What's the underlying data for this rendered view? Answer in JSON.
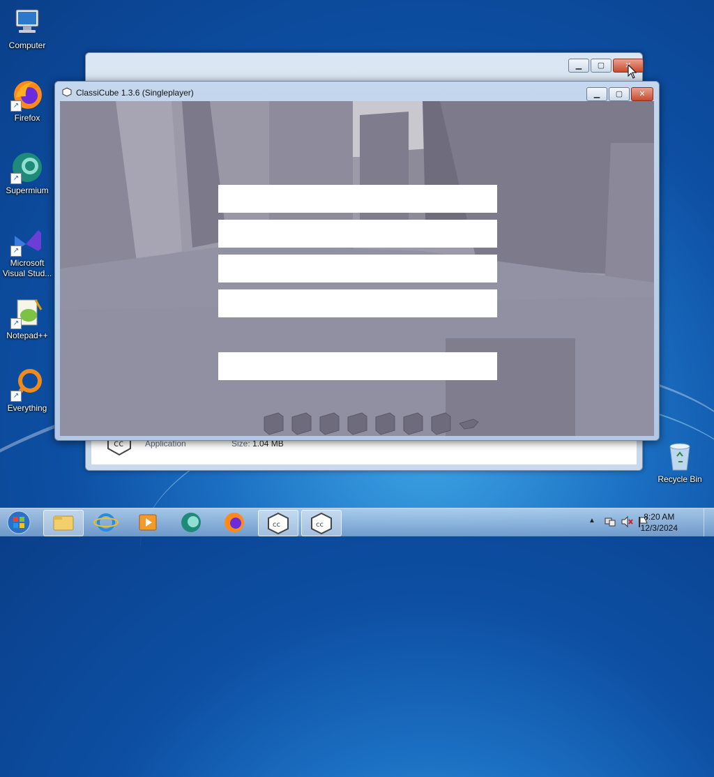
{
  "desktop": {
    "icons": [
      {
        "label": "Computer",
        "icon": "computer-icon"
      },
      {
        "label": "Firefox",
        "icon": "firefox-icon"
      },
      {
        "label": "Supermium",
        "icon": "supermium-icon"
      },
      {
        "label": "Microsoft Visual Stud...",
        "icon": "visual-studio-icon"
      },
      {
        "label": "Notepad++",
        "icon": "notepadpp-icon"
      },
      {
        "label": "Everything",
        "icon": "everything-icon"
      },
      {
        "label": "Recycle Bin",
        "icon": "recycle-bin-icon"
      }
    ]
  },
  "background_window": {
    "details": {
      "type_label": "Application",
      "size_label": "Size:",
      "size_value": "1.04 MB"
    }
  },
  "classicube_window": {
    "title": "ClassiCube 1.3.6 (Singleplayer)",
    "menu_buttons": [
      "",
      "",
      "",
      "",
      ""
    ]
  },
  "taskbar": {
    "items": [
      "start-orb",
      "file-explorer",
      "internet-explorer",
      "media-player",
      "supermium",
      "firefox",
      "classicube-1",
      "classicube-2"
    ],
    "clock": {
      "time": "8:20 AM",
      "date": "12/3/2024"
    }
  },
  "colors": {
    "accent": "#1b6fc2",
    "close_button": "#c84b2f",
    "menu_button": "#ffffff",
    "viewport_sky": "#8c8aa0"
  }
}
